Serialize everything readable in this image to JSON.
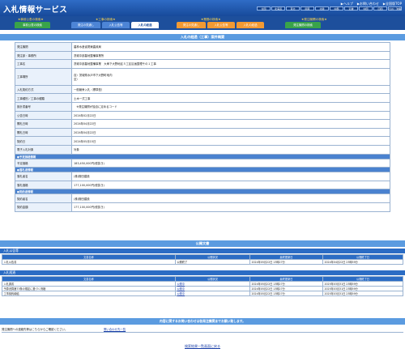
{
  "header": {
    "logo": "入札情報サービス",
    "toplinks": [
      "▶ヘルプ",
      "▶お問い合わせ",
      "▶全国版TOP"
    ],
    "regions_row1": [
      "全国",
      "北海道",
      "東北",
      "関東",
      "北陸",
      "中部",
      "近畿",
      "中国",
      "四国",
      "九州・沖縄"
    ],
    "regions_row2": [
      "",
      "",
      "",
      "",
      "",
      "",
      "近畿",
      "中国",
      "四国",
      "九州・沖縄"
    ]
  },
  "nav": {
    "groups": [
      "★事前公表の検索★",
      "★工事の検索★",
      "★業務の検索★",
      "★発注機関の検索★"
    ],
    "tabs": [
      "事前公表の検索",
      "発注の見通し",
      "入札公告等",
      "入札の経過",
      "発注の見通し",
      "入札公告等",
      "入札の経過",
      "発注機関の検索"
    ]
  },
  "section_title": "入札の経過（工事）案件概要",
  "detail": {
    "rows": [
      {
        "k": "発注機関",
        "v": "農林水産省関東農政局"
      },
      {
        "k": "発注部・事務所",
        "v": "茨城中部農地整備事業所"
      },
      {
        "k": "工事名",
        "v": "茨城中部農地整備事業　大串下大野地区５工区区画整理その１工事"
      },
      {
        "k": "工事場所",
        "v": "自）茨城県水戸市下大野町地内\n至）"
      },
      {
        "k": "入札契約方式",
        "v": "一般競争入札（標準型）"
      },
      {
        "k": "工事種別／工事の種類",
        "v": "土木一式工事"
      },
      {
        "k": "設計書番号",
        "v": "　※発注機関が独自に定めるコード"
      },
      {
        "k": "公告日時",
        "v": "2024年02月22日"
      },
      {
        "k": "開札日時",
        "v": "2024年04月22日"
      },
      {
        "k": "開札日時",
        "v": "2024年04月22日"
      },
      {
        "k": "契約日",
        "v": "2024年05月15日"
      },
      {
        "k": "電子入札対象",
        "v": "対象"
      }
    ],
    "price_header": "●予定価格情報",
    "price_row": {
      "k": "予定価格",
      "v": "183,450,000円(税抜き)"
    },
    "winner_header": "●落札者情報",
    "winner_rows": [
      {
        "k": "落札者名",
        "v": "(株)檜田建設"
      },
      {
        "k": "落札価格",
        "v": "177,100,000円(税抜き)"
      }
    ],
    "contract_header": "●契約者情報",
    "contract_rows": [
      {
        "k": "契約者名",
        "v": "(株)檜田建設"
      },
      {
        "k": "契約金額",
        "v": "177,100,000円(税抜き)"
      }
    ]
  },
  "public_docs": {
    "title": "公開文書",
    "notice_title": "入札公告等",
    "columns": [
      "文書名称",
      "公開状況",
      "最終更新日",
      "公開終了日"
    ],
    "notice_rows": [
      [
        "入札公告書",
        "公開終了",
        "2024年05月22日 13時27分",
        "2024年04月22日 23時59分"
      ]
    ],
    "progress_title": "入札経過",
    "progress_rows": [
      [
        "入札調書",
        "公開中",
        "2024年05月22日 13時27分",
        "2025年03月31日 23時59分"
      ],
      [
        "予算決算第73条の規定に基づく資格",
        "公開中",
        "2024年05月22日 13時27分",
        "2025年03月31日 23時59分"
      ],
      [
        "工事契約締結",
        "公開中",
        "2024年05月22日 13時27分",
        "2025年03月31日 23時59分"
      ]
    ]
  },
  "contact": {
    "bar": "内容に関するお問い合わせは各発注機関までお願い致します。",
    "label": "発注機関への連絡先等はこちらからご確認ください。",
    "link": "問い合わせ先一覧"
  },
  "footer": {
    "back": "検索結果一覧画面に戻る"
  }
}
